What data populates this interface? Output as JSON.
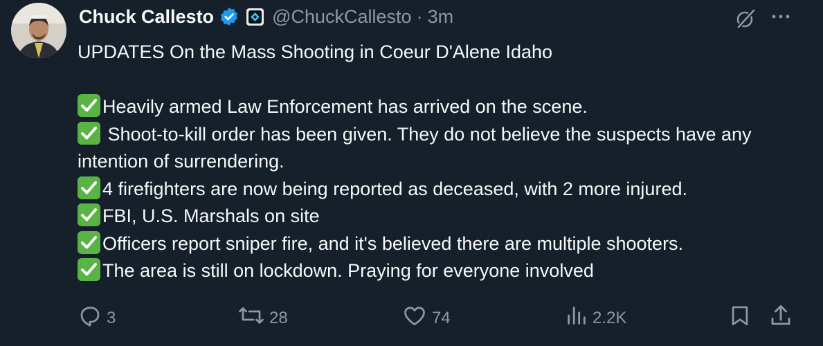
{
  "user": {
    "name": "Chuck Callesto",
    "handle": "@ChuckCallesto",
    "separator": "·",
    "time": "3m"
  },
  "tweet": {
    "headline": "UPDATES On the Mass Shooting in Coeur D'Alene Idaho",
    "lines": [
      "Heavily armed Law Enforcement has arrived on the scene.",
      " Shoot-to-kill order has been given. They do not believe the suspects have any intention of surrendering.",
      "4 firefighters are now being reported as deceased, with 2 more injured.",
      "FBI, U.S. Marshals on site",
      "Officers report sniper fire, and it's believed there are multiple shooters.",
      "The area is still on lockdown. Praying for everyone involved"
    ]
  },
  "stats": {
    "replies": "3",
    "reposts": "28",
    "likes": "74",
    "views": "2.2K"
  },
  "icons": {
    "reply": "reply-icon",
    "repost": "repost-icon",
    "like": "heart-icon",
    "views": "views-icon",
    "bookmark": "bookmark-icon",
    "share": "share-icon",
    "verified": "verified-badge-icon",
    "grok": "grok-icon",
    "more": "more-icon",
    "check": "check-mark-icon"
  },
  "colors": {
    "background": "#15202b",
    "text": "#f7f9f9",
    "secondary": "#8b98a5",
    "verified": "#1d9bf0",
    "check": "#59b345"
  }
}
